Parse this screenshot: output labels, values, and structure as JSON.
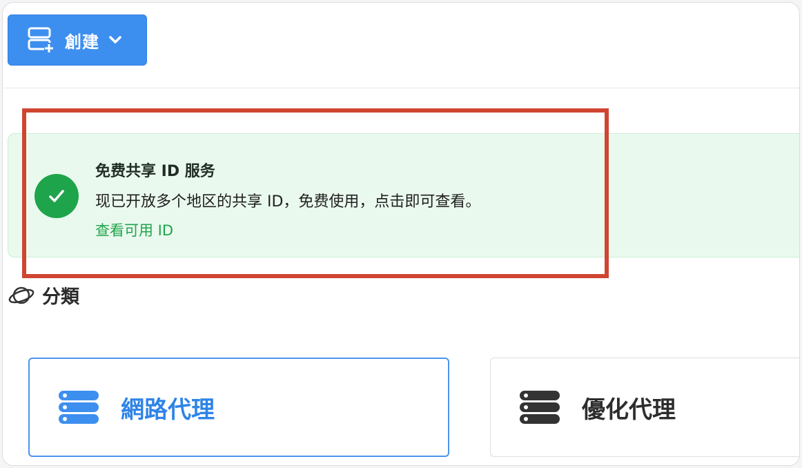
{
  "toolbar": {
    "create_label": "創建"
  },
  "alert": {
    "title": "免费共享 ID 服务",
    "text": "现已开放多个地区的共享 ID，免费使用，点击即可查看。",
    "link": "查看可用 ID"
  },
  "section": {
    "title": "分類"
  },
  "cards": [
    {
      "label": "網路代理",
      "icon": "server-stack-icon",
      "selected": true
    },
    {
      "label": "優化代理",
      "icon": "server-stack-icon",
      "selected": false
    }
  ],
  "colors": {
    "primary": "#3d8fef",
    "success": "#1ea44b",
    "alert_bg": "#eaf9ee",
    "highlight": "#cf4531"
  }
}
